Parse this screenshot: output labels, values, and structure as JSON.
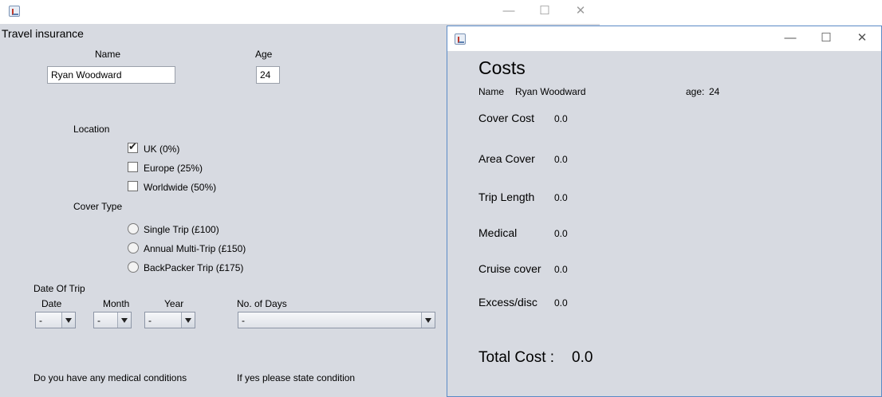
{
  "main_window": {
    "title": "Travel insurance",
    "controls": {
      "minimize": "—",
      "maximize": "☐",
      "close": "✕"
    },
    "name_label": "Name",
    "name_value": "Ryan Woodward",
    "age_label": "Age",
    "age_value": "24",
    "location_label": "Location",
    "locations": [
      {
        "label": "UK (0%)",
        "checked": true
      },
      {
        "label": "Europe (25%)",
        "checked": false
      },
      {
        "label": "Worldwide (50%)",
        "checked": false
      }
    ],
    "cover_type_label": "Cover Type",
    "cover_types": [
      {
        "label": "Single Trip (£100)"
      },
      {
        "label": "Annual Multi-Trip (£150)"
      },
      {
        "label": "BackPacker Trip (£175)"
      }
    ],
    "date_of_trip_label": "Date Of Trip",
    "date_label": "Date",
    "month_label": "Month",
    "year_label": "Year",
    "days_label": "No. of Days",
    "date_value": "-",
    "month_value": "-",
    "year_value": "-",
    "days_value": "-",
    "medical_question": "Do you have any medical conditions",
    "medical_state": "If yes please  state condition"
  },
  "costs_window": {
    "controls": {
      "minimize": "—",
      "maximize": "☐",
      "close": "✕"
    },
    "heading": "Costs",
    "name_label": "Name",
    "name_value": "Ryan Woodward",
    "age_label": "age:",
    "age_value": "24",
    "rows": [
      {
        "label": "Cover Cost",
        "value": "0.0"
      },
      {
        "label": "Area Cover",
        "value": "0.0"
      },
      {
        "label": "Trip Length",
        "value": "0.0"
      },
      {
        "label": "Medical",
        "value": "0.0"
      },
      {
        "label": "Cruise cover",
        "value": "0.0"
      },
      {
        "label": "Excess/disc",
        "value": "0.0"
      }
    ],
    "total_label": "Total Cost :",
    "total_value": "0.0"
  }
}
